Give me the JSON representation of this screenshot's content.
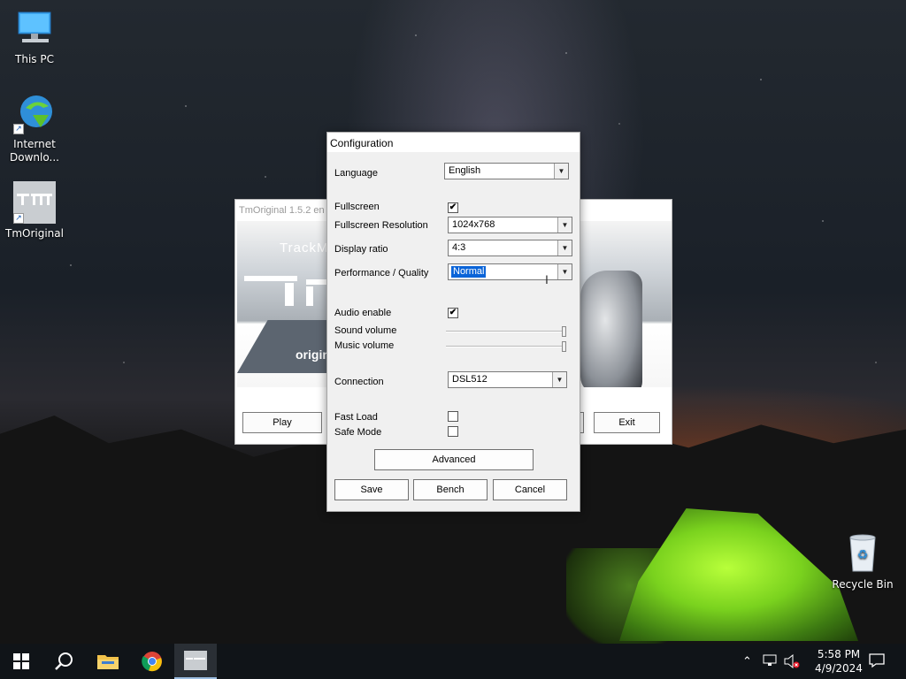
{
  "desktop": {
    "icons": [
      {
        "label": "This PC",
        "icon": "this-pc-icon"
      },
      {
        "label": "Internet Downlo...",
        "icon": "internet-download-manager-icon"
      },
      {
        "label": "TmOriginal",
        "icon": "tmoriginal-icon"
      },
      {
        "label": "Recycle Bin",
        "icon": "recycle-bin-icon"
      }
    ]
  },
  "launcher": {
    "title": "TmOriginal 1.5.2 en",
    "logo_text": "TrackM",
    "origin_text": "origin",
    "play_label": "Play",
    "exit_label": "Exit"
  },
  "config": {
    "title": "Configuration",
    "language": {
      "label": "Language",
      "value": "English"
    },
    "fullscreen": {
      "label": "Fullscreen",
      "checked": true,
      "mark": "✔"
    },
    "resolution": {
      "label": "Fullscreen Resolution",
      "value": "1024x768"
    },
    "display_ratio": {
      "label": "Display ratio",
      "value": "4:3"
    },
    "performance": {
      "label": "Performance / Quality",
      "value": "Normal"
    },
    "audio": {
      "label": "Audio enable",
      "checked": true,
      "mark": "✔"
    },
    "sound_volume": {
      "label": "Sound volume",
      "level": 1.0
    },
    "music_volume": {
      "label": "Music volume",
      "level": 1.0
    },
    "connection": {
      "label": "Connection",
      "value": "DSL512"
    },
    "fast_load": {
      "label": "Fast Load",
      "checked": false
    },
    "safe_mode": {
      "label": "Safe Mode",
      "checked": false
    },
    "advanced_label": "Advanced",
    "save_label": "Save",
    "bench_label": "Bench",
    "cancel_label": "Cancel"
  },
  "taskbar": {
    "time": "5:58 PM",
    "date": "4/9/2024",
    "pinned": [
      "start-icon",
      "search-icon",
      "file-explorer-icon",
      "chrome-icon",
      "tmoriginal-icon"
    ]
  },
  "colors": {
    "selection": "#0a64d8",
    "taskbar": "#101418",
    "dialog_bg": "#f0f0f0"
  }
}
